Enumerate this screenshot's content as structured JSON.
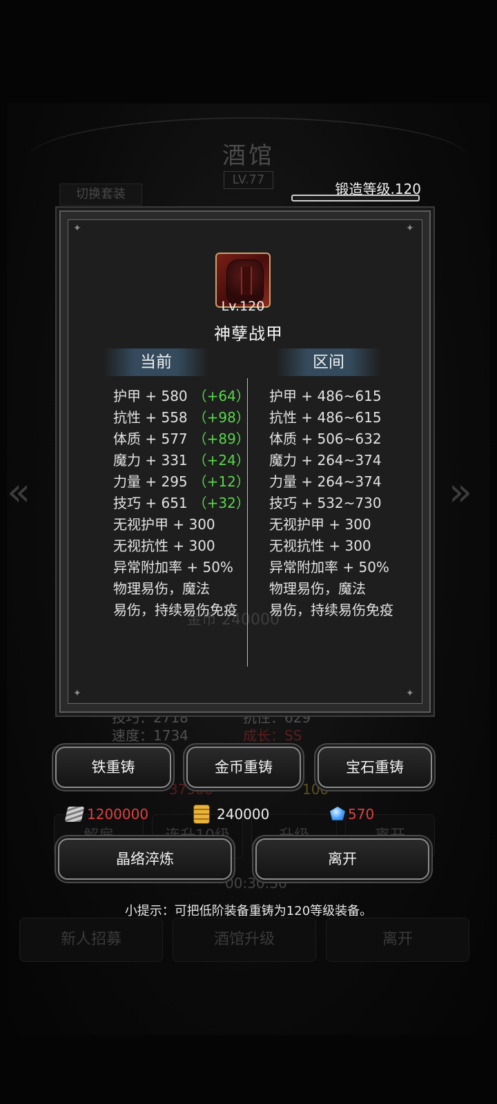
{
  "background": {
    "title": "酒馆",
    "level": "LV.77",
    "switch_button": "切换套装",
    "gold_faint": "金币 240000",
    "stat_faint_1": "技巧：2718",
    "stat_faint_2": "抗性：629",
    "stat_faint_3": "速度：1734",
    "stat_faint_4": "成长：SS",
    "num_faint_1": "37500",
    "num_faint_2": "100",
    "row_buttons": [
      "解雇",
      "连升10级",
      "升级",
      "离开"
    ],
    "timer": "00:30:30",
    "bottom_buttons": [
      "新人招募",
      "酒馆升级",
      "离开"
    ]
  },
  "forge": {
    "label": "锻造等级.120",
    "progress": 0.0
  },
  "item": {
    "icon": "armor-icon",
    "level": "Lv.120",
    "name": "神孽战甲"
  },
  "columns": {
    "current": "当前",
    "range": "区间"
  },
  "current_stats": [
    {
      "text": "护甲 + 580",
      "bonus": "（+64）"
    },
    {
      "text": "抗性 + 558",
      "bonus": "（+98）"
    },
    {
      "text": "体质 + 577",
      "bonus": "（+89）"
    },
    {
      "text": "魔力 + 331",
      "bonus": "（+24）"
    },
    {
      "text": "力量 + 295",
      "bonus": "（+12）"
    },
    {
      "text": "技巧 + 651",
      "bonus": "（+32）"
    },
    {
      "text": "无视护甲 + 300",
      "bonus": ""
    },
    {
      "text": "无视抗性 + 300",
      "bonus": ""
    },
    {
      "text": "异常附加率 + 50%",
      "bonus": ""
    },
    {
      "text": "物理易伤，魔法",
      "bonus": ""
    },
    {
      "text": "易伤，持续易伤免疫",
      "bonus": ""
    }
  ],
  "range_stats": [
    "护甲 + 486~615",
    "抗性 + 486~615",
    "体质 + 506~632",
    "魔力 + 264~374",
    "力量 + 264~374",
    "技巧 + 532~730",
    "无视护甲 + 300",
    "无视抗性 + 300",
    "异常附加率 + 50%",
    "物理易伤，魔法",
    "易伤，持续易伤免疫"
  ],
  "actions": {
    "iron_reforge": "铁重铸",
    "gold_reforge": "金币重铸",
    "gem_reforge": "宝石重铸",
    "crystal_refine": "晶络淬炼",
    "leave": "离开"
  },
  "currency": {
    "iron": "1200000",
    "gold": "240000",
    "gem": "570",
    "iron_color": "#e04040",
    "gold_color": "#f0f0f0",
    "gem_color": "#e04040"
  },
  "hint": "小提示：可把低阶装备重铸为120等级装备。"
}
